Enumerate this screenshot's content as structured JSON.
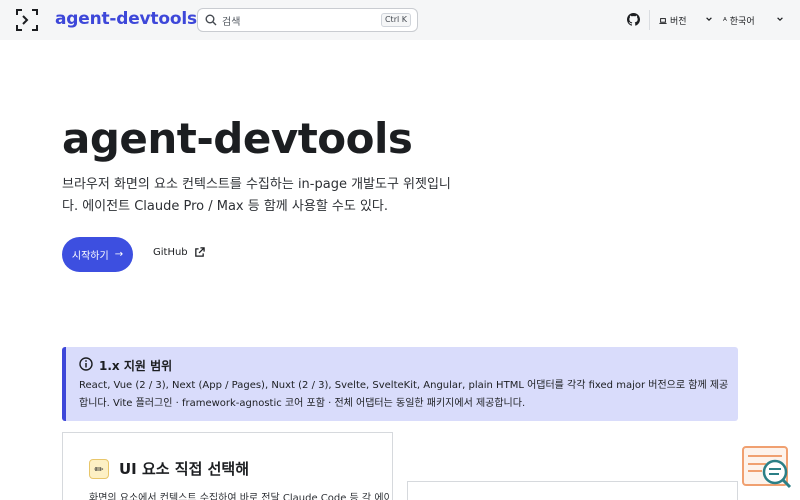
{
  "navbar": {
    "brand": "agent-devtools",
    "search_placeholder": "검색",
    "search_shortcut": "Ctrl K",
    "version_label": "버전",
    "language_label": "한국어",
    "icons": [
      "logo-icon",
      "search-icon",
      "github-icon",
      "laptop-icon",
      "chevron-down-icon",
      "translate-icon"
    ]
  },
  "hero": {
    "title": "agent-devtools",
    "description": "브라우저 화면의 요소 컨텍스트를 수집하는 in-page 개발도구 위젯입니다. 에이전트 Claude Pro / Max 등 함께 사용할 수도 있다.",
    "start_button": "시작하기",
    "start_arrow": "→",
    "github_button": "GitHub"
  },
  "admonition": {
    "title": "1.x 지원 범위",
    "body": "React, Vue (2 / 3), Next (App / Pages), Nuxt (2 / 3), Svelte, SvelteKit, Angular, plain HTML 어댑터를 각각 fixed major 버전으로 함께 제공합니다. Vite 플러그인 · framework-agnostic 코어 포함 · 전체 어댑터는 동일한 패키지에서 제공합니다."
  },
  "card": {
    "icon": "✏",
    "title": "UI 요소 직접 선택해",
    "description": "화면의 요소에서 컨텍스트 수집하여 바로 전달 Claude Code 등 각 에이전트 세션에 붙 보내기"
  },
  "colors": {
    "accent": "#3d47d9",
    "button": "#3d4fe0",
    "admonition_bg": "#d9dcfb",
    "navbar_bg": "#f5f6f7",
    "widget_orange": "#f0a070",
    "widget_teal": "#2b7f86"
  }
}
